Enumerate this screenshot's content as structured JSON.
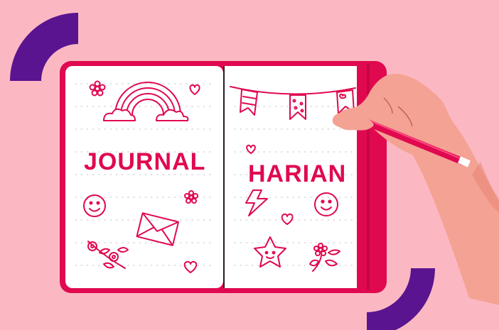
{
  "illustration": {
    "left_page_word": "JOURNAL",
    "right_page_word": "HARIAN"
  },
  "colors": {
    "background": "#fbb8c3",
    "accent_pink": "#e0094f",
    "purple": "#5a1490",
    "page": "#ffffff",
    "skin": "#f4a293"
  },
  "icons": [
    "rainbow-icon",
    "flower-icon",
    "heart-icon",
    "smiley-icon",
    "envelope-icon",
    "bunting-icon",
    "lightning-icon",
    "star-icon",
    "leaf-icon",
    "pencil-icon",
    "hand"
  ]
}
